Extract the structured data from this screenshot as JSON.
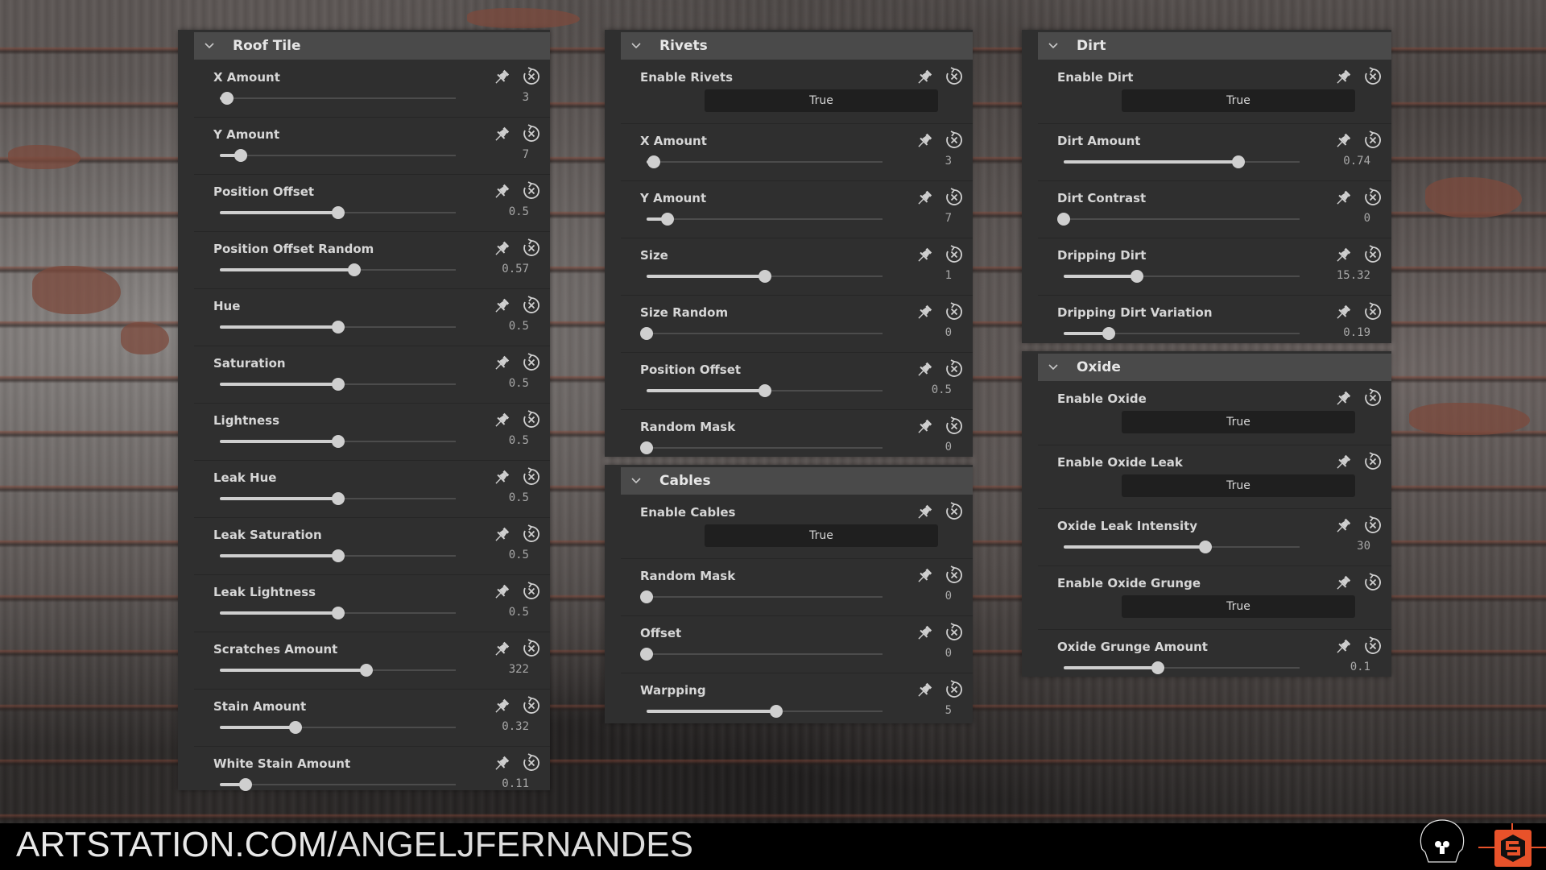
{
  "panels": [
    {
      "title": "Roof Tile",
      "rows": [
        {
          "type": "slider",
          "label": "X Amount",
          "value": "3",
          "fraction": 0.03
        },
        {
          "type": "slider",
          "label": "Y Amount",
          "value": "7",
          "fraction": 0.09
        },
        {
          "type": "slider",
          "label": "Position Offset",
          "value": "0.5",
          "fraction": 0.5
        },
        {
          "type": "slider",
          "label": "Position Offset Random",
          "value": "0.57",
          "fraction": 0.57
        },
        {
          "type": "slider",
          "label": "Hue",
          "value": "0.5",
          "fraction": 0.5
        },
        {
          "type": "slider",
          "label": "Saturation",
          "value": "0.5",
          "fraction": 0.5
        },
        {
          "type": "slider",
          "label": "Lightness",
          "value": "0.5",
          "fraction": 0.5
        },
        {
          "type": "slider",
          "label": "Leak Hue",
          "value": "0.5",
          "fraction": 0.5
        },
        {
          "type": "slider",
          "label": "Leak Saturation",
          "value": "0.5",
          "fraction": 0.5
        },
        {
          "type": "slider",
          "label": "Leak Lightness",
          "value": "0.5",
          "fraction": 0.5
        },
        {
          "type": "slider",
          "label": "Scratches Amount",
          "value": "322",
          "fraction": 0.62
        },
        {
          "type": "slider",
          "label": "Stain Amount",
          "value": "0.32",
          "fraction": 0.32
        },
        {
          "type": "slider",
          "label": "White Stain Amount",
          "value": "0.11",
          "fraction": 0.11
        }
      ]
    },
    {
      "title": "Rivets",
      "rows": [
        {
          "type": "bool",
          "label": "Enable Rivets",
          "value": "True"
        },
        {
          "type": "slider",
          "label": "X Amount",
          "value": "3",
          "fraction": 0.03
        },
        {
          "type": "slider",
          "label": "Y Amount",
          "value": "7",
          "fraction": 0.09
        },
        {
          "type": "slider",
          "label": "Size",
          "value": "1",
          "fraction": 0.5
        },
        {
          "type": "slider",
          "label": "Size Random",
          "value": "0",
          "fraction": 0
        },
        {
          "type": "slider",
          "label": "Position Offset",
          "value": "0.5",
          "fraction": 0.5
        },
        {
          "type": "slider",
          "label": "Random Mask",
          "value": "0",
          "fraction": 0
        }
      ]
    },
    {
      "title": "Cables",
      "rows": [
        {
          "type": "bool",
          "label": "Enable Cables",
          "value": "True"
        },
        {
          "type": "slider",
          "label": "Random Mask",
          "value": "0",
          "fraction": 0
        },
        {
          "type": "slider",
          "label": "Offset",
          "value": "0",
          "fraction": 0
        },
        {
          "type": "slider",
          "label": "Warpping",
          "value": "5",
          "fraction": 0.55
        }
      ]
    },
    {
      "title": "Dirt",
      "rows": [
        {
          "type": "bool",
          "label": "Enable Dirt",
          "value": "True"
        },
        {
          "type": "slider",
          "label": "Dirt Amount",
          "value": "0.74",
          "fraction": 0.74
        },
        {
          "type": "slider",
          "label": "Dirt Contrast",
          "value": "0",
          "fraction": 0
        },
        {
          "type": "slider",
          "label": "Dripping Dirt",
          "value": "15.32",
          "fraction": 0.31
        },
        {
          "type": "slider",
          "label": "Dripping Dirt Variation",
          "value": "0.19",
          "fraction": 0.19
        }
      ]
    },
    {
      "title": "Oxide",
      "rows": [
        {
          "type": "bool",
          "label": "Enable Oxide",
          "value": "True"
        },
        {
          "type": "bool",
          "label": "Enable Oxide Leak",
          "value": "True"
        },
        {
          "type": "slider",
          "label": "Oxide Leak Intensity",
          "value": "30",
          "fraction": 0.6
        },
        {
          "type": "bool",
          "label": "Enable Oxide Grunge",
          "value": "True"
        },
        {
          "type": "slider",
          "label": "Oxide Grunge Amount",
          "value": "0.1",
          "fraction": 0.4
        }
      ]
    }
  ],
  "icons": {
    "collapse": "chevron-down-icon",
    "pin": "pin-icon",
    "reset": "reset-icon"
  },
  "footer": {
    "site_bold": "ARTSTATION.COM/",
    "site_name": "ANGELJFERNANDES",
    "logos": [
      "skull-logo-icon",
      "substance-designer-logo-icon"
    ]
  },
  "colors": {
    "panel_bg": "#2f2f2f",
    "header_bg": "#4a4a4a",
    "bool_bg": "#1f1f1f",
    "slider_fill": "#cfcfcf",
    "substance_orange": "#e8522a"
  }
}
